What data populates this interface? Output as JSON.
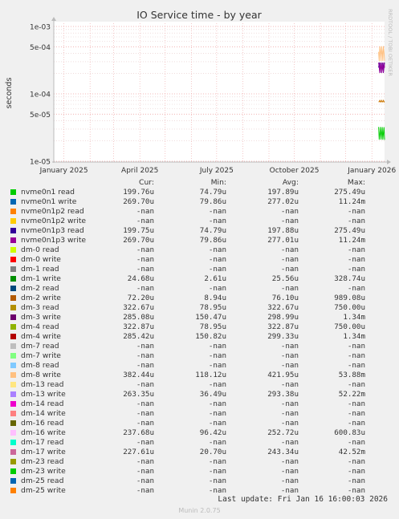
{
  "chart_data": {
    "type": "line",
    "title": "IO Service time - by year",
    "ylabel": "seconds",
    "yscale": "log",
    "ylim": [
      "1e-05",
      "1e-03"
    ],
    "y_ticks": [
      "1e-03",
      "5e-04",
      "1e-04",
      "5e-05",
      "1e-05"
    ],
    "x_ticks": [
      "January 2025",
      "April 2025",
      "July 2025",
      "October 2025",
      "January 2026"
    ],
    "watermark": "RRDTOOL / TOBI OETIKER",
    "grid": true,
    "series_visible": [
      {
        "name": "nvme0n1p3 read",
        "color": "#330099",
        "x": "January 2026",
        "y_range": [
          "2e-04",
          "3e-04"
        ]
      },
      {
        "name": "nvme0n1p3 write",
        "color": "#990099",
        "x": "January 2026",
        "y_range": [
          "2e-04",
          "3e-04"
        ]
      },
      {
        "name": "dm-1 write",
        "color": "#00CC00",
        "x": "January 2026",
        "y_range": [
          "2e-05",
          "3.3e-05"
        ]
      },
      {
        "name": "dm-8 write",
        "color": "#FFC080",
        "x": "January 2026",
        "y_range": [
          "3e-04",
          "5.4e-04"
        ]
      },
      {
        "name": "dm-2 write",
        "color": "#CC7700",
        "x": "January 2026",
        "y_range": [
          "7.5e-05",
          "8e-05"
        ]
      }
    ]
  },
  "legend": {
    "headers": [
      "Cur:",
      "Min:",
      "Avg:",
      "Max:"
    ],
    "rows": [
      {
        "name": "nvme0n1 read",
        "color": "#00CC00",
        "cur": "199.76u",
        "min": "74.79u",
        "avg": "197.89u",
        "max": "275.49u"
      },
      {
        "name": "nvme0n1 write",
        "color": "#0066B3",
        "cur": "269.70u",
        "min": "79.86u",
        "avg": "277.02u",
        "max": "11.24m"
      },
      {
        "name": "nvme0n1p2 read",
        "color": "#FF8000",
        "cur": "-nan",
        "min": "-nan",
        "avg": "-nan",
        "max": "-nan"
      },
      {
        "name": "nvme0n1p2 write",
        "color": "#FFCC00",
        "cur": "-nan",
        "min": "-nan",
        "avg": "-nan",
        "max": "-nan"
      },
      {
        "name": "nvme0n1p3 read",
        "color": "#330099",
        "cur": "199.75u",
        "min": "74.79u",
        "avg": "197.88u",
        "max": "275.49u"
      },
      {
        "name": "nvme0n1p3 write",
        "color": "#990099",
        "cur": "269.70u",
        "min": "79.86u",
        "avg": "277.01u",
        "max": "11.24m"
      },
      {
        "name": "dm-0 read",
        "color": "#CCFF00",
        "cur": "-nan",
        "min": "-nan",
        "avg": "-nan",
        "max": "-nan"
      },
      {
        "name": "dm-0 write",
        "color": "#FF0000",
        "cur": "-nan",
        "min": "-nan",
        "avg": "-nan",
        "max": "-nan"
      },
      {
        "name": "dm-1 read",
        "color": "#808080",
        "cur": "-nan",
        "min": "-nan",
        "avg": "-nan",
        "max": "-nan"
      },
      {
        "name": "dm-1 write",
        "color": "#008F00",
        "cur": "24.68u",
        "min": "2.61u",
        "avg": "25.56u",
        "max": "328.74u"
      },
      {
        "name": "dm-2 read",
        "color": "#00487D",
        "cur": "-nan",
        "min": "-nan",
        "avg": "-nan",
        "max": "-nan"
      },
      {
        "name": "dm-2 write",
        "color": "#B35A00",
        "cur": "72.20u",
        "min": "8.94u",
        "avg": "76.10u",
        "max": "989.08u"
      },
      {
        "name": "dm-3 read",
        "color": "#B38F00",
        "cur": "322.67u",
        "min": "78.95u",
        "avg": "322.67u",
        "max": "750.00u"
      },
      {
        "name": "dm-3 write",
        "color": "#6B006B",
        "cur": "285.08u",
        "min": "150.47u",
        "avg": "298.99u",
        "max": "1.34m"
      },
      {
        "name": "dm-4 read",
        "color": "#8FB300",
        "cur": "322.87u",
        "min": "78.95u",
        "avg": "322.87u",
        "max": "750.00u"
      },
      {
        "name": "dm-4 write",
        "color": "#B30000",
        "cur": "285.42u",
        "min": "150.82u",
        "avg": "299.33u",
        "max": "1.34m"
      },
      {
        "name": "dm-7 read",
        "color": "#BEBEBE",
        "cur": "-nan",
        "min": "-nan",
        "avg": "-nan",
        "max": "-nan"
      },
      {
        "name": "dm-7 write",
        "color": "#80FF80",
        "cur": "-nan",
        "min": "-nan",
        "avg": "-nan",
        "max": "-nan"
      },
      {
        "name": "dm-8 read",
        "color": "#80C9FF",
        "cur": "-nan",
        "min": "-nan",
        "avg": "-nan",
        "max": "-nan"
      },
      {
        "name": "dm-8 write",
        "color": "#FFC080",
        "cur": "382.44u",
        "min": "118.12u",
        "avg": "421.95u",
        "max": "53.88m"
      },
      {
        "name": "dm-13 read",
        "color": "#FFE680",
        "cur": "-nan",
        "min": "-nan",
        "avg": "-nan",
        "max": "-nan"
      },
      {
        "name": "dm-13 write",
        "color": "#AA80FF",
        "cur": "263.35u",
        "min": "36.49u",
        "avg": "293.38u",
        "max": "52.22m"
      },
      {
        "name": "dm-14 read",
        "color": "#EE00CC",
        "cur": "-nan",
        "min": "-nan",
        "avg": "-nan",
        "max": "-nan"
      },
      {
        "name": "dm-14 write",
        "color": "#FF8080",
        "cur": "-nan",
        "min": "-nan",
        "avg": "-nan",
        "max": "-nan"
      },
      {
        "name": "dm-16 read",
        "color": "#666600",
        "cur": "-nan",
        "min": "-nan",
        "avg": "-nan",
        "max": "-nan"
      },
      {
        "name": "dm-16 write",
        "color": "#FFBFFF",
        "cur": "237.68u",
        "min": "96.42u",
        "avg": "252.72u",
        "max": "600.83u"
      },
      {
        "name": "dm-17 read",
        "color": "#00FFCC",
        "cur": "-nan",
        "min": "-nan",
        "avg": "-nan",
        "max": "-nan"
      },
      {
        "name": "dm-17 write",
        "color": "#CC6699",
        "cur": "227.61u",
        "min": "20.70u",
        "avg": "243.34u",
        "max": "42.52m"
      },
      {
        "name": "dm-23 read",
        "color": "#999900",
        "cur": "-nan",
        "min": "-nan",
        "avg": "-nan",
        "max": "-nan"
      },
      {
        "name": "dm-23 write",
        "color": "#00CC00",
        "cur": "-nan",
        "min": "-nan",
        "avg": "-nan",
        "max": "-nan"
      },
      {
        "name": "dm-25 read",
        "color": "#0066B3",
        "cur": "-nan",
        "min": "-nan",
        "avg": "-nan",
        "max": "-nan"
      },
      {
        "name": "dm-25 write",
        "color": "#FF8000",
        "cur": "-nan",
        "min": "-nan",
        "avg": "-nan",
        "max": "-nan"
      }
    ]
  },
  "footer": {
    "last_update": "Last update: Fri Jan 16 16:00:03 2026",
    "munin": "Munin 2.0.75"
  }
}
